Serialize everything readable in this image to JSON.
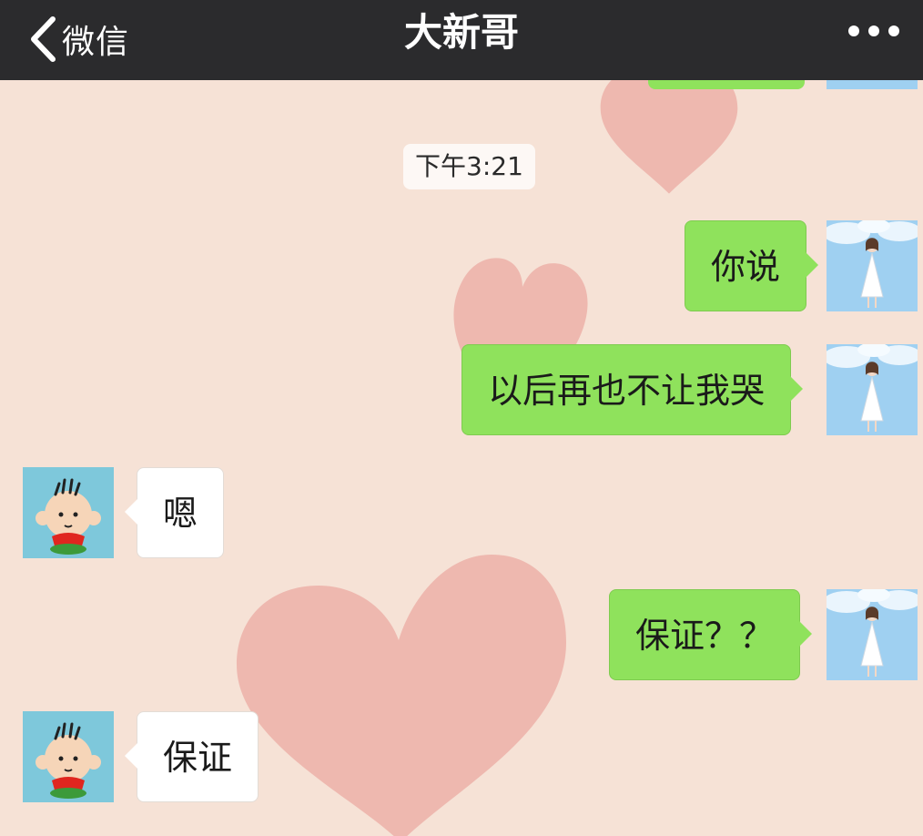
{
  "navbar": {
    "back_label": "微信",
    "title": "大新哥",
    "more_icon": "more-dots-icon"
  },
  "chat": {
    "timestamp": "下午3:21",
    "messages": [
      {
        "side": "sent",
        "text": "你说"
      },
      {
        "side": "sent",
        "text": "以后再也不让我哭"
      },
      {
        "side": "received",
        "text": "嗯"
      },
      {
        "side": "sent",
        "text": "保证？？"
      },
      {
        "side": "received",
        "text": "保证"
      }
    ]
  },
  "colors": {
    "navbar": "#2b2b2d",
    "background": "#f6e2d6",
    "sent_bubble": "#8fe25c",
    "received_bubble": "#ffffff",
    "heart": "#e8968f"
  }
}
